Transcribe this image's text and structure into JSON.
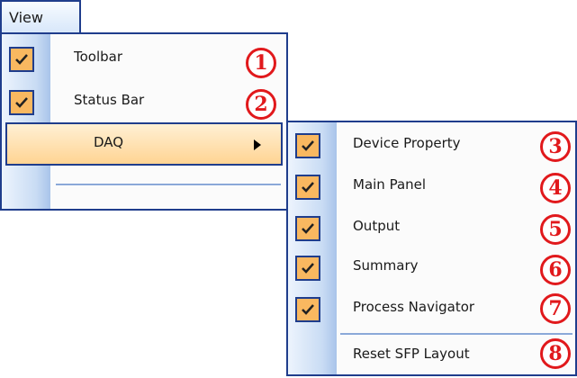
{
  "menubar": {
    "view_label": "View"
  },
  "view_menu": {
    "items": [
      {
        "label": "Toolbar",
        "checked": true,
        "badge": "1"
      },
      {
        "label": "Status Bar",
        "checked": true,
        "badge": "2"
      },
      {
        "label": "DAQ",
        "has_submenu": true,
        "highlighted": true
      }
    ]
  },
  "daq_submenu": {
    "items": [
      {
        "label": "Device Property",
        "checked": true,
        "badge": "3"
      },
      {
        "label": "Main Panel",
        "checked": true,
        "badge": "4"
      },
      {
        "label": "Output",
        "checked": true,
        "badge": "5"
      },
      {
        "label": "Summary",
        "checked": true,
        "badge": "6"
      },
      {
        "label": "Process Navigator",
        "checked": true,
        "badge": "7"
      },
      {
        "label": "Reset SFP Layout",
        "checked": false,
        "badge": "8"
      }
    ]
  },
  "colors": {
    "accent_border": "#1f3d8c",
    "check_bg": "#f9b860",
    "badge_red": "#e1191c",
    "highlight": "#ffd493"
  },
  "icons": {
    "check": "check-icon",
    "submenu_arrow": "chevron-right-icon"
  }
}
